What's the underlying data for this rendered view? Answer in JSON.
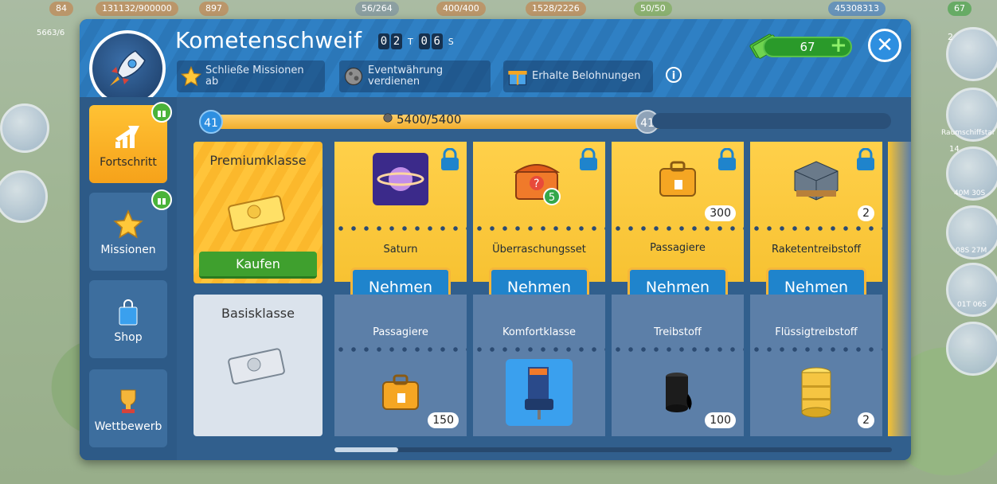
{
  "topbar": {
    "items": [
      "84",
      "131132/900000",
      "897",
      "56/264",
      "400/400",
      "1528/2226",
      "50/50",
      "45308313",
      "67"
    ],
    "left_sub": "5663/6"
  },
  "side_right": {
    "badge_num": "2",
    "label1": "Raumschiffstar",
    "badge_num2": "14",
    "label2": "40M 30S",
    "label3": "08S 27M",
    "label4": "01T 06S"
  },
  "panel": {
    "title": "Kometenschweif",
    "timer": {
      "d1": "0",
      "d2": "2",
      "unit1": "T",
      "d3": "0",
      "d4": "6",
      "unit2": "S"
    },
    "steps": [
      {
        "label": "Schließe Missionen ab",
        "icon": "star-icon"
      },
      {
        "label": "Eventwährung verdienen",
        "icon": "meteor-icon"
      },
      {
        "label": "Erhalte Belohnungen",
        "icon": "gift-icon"
      }
    ],
    "info": "i",
    "cash": "67",
    "close": "✕"
  },
  "nav": [
    {
      "label": "Fortschritt",
      "icon": "progress-arrow-icon",
      "active": true,
      "badge": true
    },
    {
      "label": "Missionen",
      "icon": "star-icon",
      "active": false,
      "badge": true
    },
    {
      "label": "Shop",
      "icon": "shopping-bag-icon",
      "active": false,
      "badge": false
    },
    {
      "label": "Wettbewerb",
      "icon": "trophy-icon",
      "active": false,
      "badge": false
    }
  ],
  "progress": {
    "level_left": "41",
    "level_right": "41",
    "text": "5400/5400",
    "fraction": 1.0
  },
  "tiers": {
    "premium": {
      "label": "Premiumklasse",
      "buy": "Kaufen"
    },
    "basic": {
      "label": "Basisklasse"
    }
  },
  "rewards": [
    {
      "premium_name": "Saturn",
      "premium_count": "",
      "premium_icon": "saturn-icon",
      "take": "Nehmen",
      "basic_name": "Passagiere",
      "basic_count": "150",
      "basic_icon": "suitcase-icon"
    },
    {
      "premium_name": "Überraschungsset",
      "premium_count": "5",
      "premium_icon": "mystery-chest-icon",
      "take": "Nehmen",
      "basic_name": "Komfortklasse",
      "basic_count": "",
      "basic_icon": "seat-icon"
    },
    {
      "premium_name": "Passagiere",
      "premium_count": "300",
      "premium_icon": "suitcase-icon",
      "take": "Nehmen",
      "basic_name": "Treibstoff",
      "basic_count": "100",
      "basic_icon": "oil-barrel-icon"
    },
    {
      "premium_name": "Raketentreibstoff",
      "premium_count": "2",
      "premium_icon": "fuel-pallet-icon",
      "take": "Nehmen",
      "basic_name": "Flüssigtreibstoff",
      "basic_count": "2",
      "basic_icon": "yellow-barrel-icon"
    }
  ],
  "colors": {
    "accent": "#2e8fe0",
    "premium": "#ffc43a",
    "buy": "#3fa02e",
    "take": "#1f84cc"
  }
}
